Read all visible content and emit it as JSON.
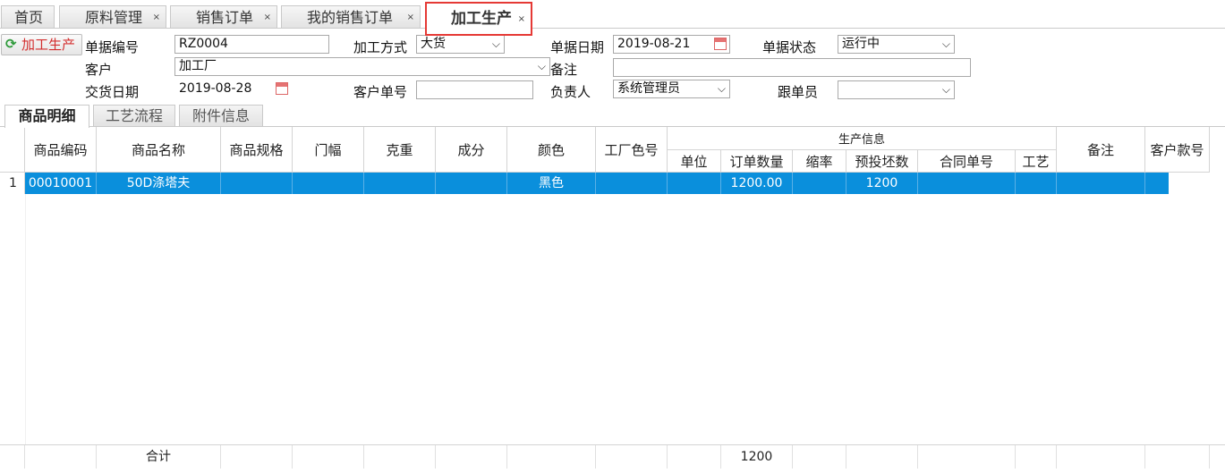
{
  "tabs": [
    {
      "label": "首页",
      "closable": false
    },
    {
      "label": "原料管理",
      "closable": true
    },
    {
      "label": "销售订单",
      "closable": true
    },
    {
      "label": "我的销售订单",
      "closable": true
    },
    {
      "label": "加工生产",
      "closable": true,
      "active": true
    }
  ],
  "close_glyph": "×",
  "action_button": {
    "label": "加工生产",
    "icon": "refresh-icon"
  },
  "form": {
    "doc_no_label": "单据编号",
    "doc_no": "RZ0004",
    "process_method_label": "加工方式",
    "process_method": "大货",
    "doc_date_label": "单据日期",
    "doc_date": "2019-08-21",
    "doc_status_label": "单据状态",
    "doc_status": "运行中",
    "customer_label": "客户",
    "customer": "加工厂",
    "remark_label": "备注",
    "remark": "",
    "delivery_date_label": "交货日期",
    "delivery_date": "2019-08-28",
    "customer_order_label": "客户单号",
    "customer_order": "",
    "owner_label": "负责人",
    "owner": "系统管理员",
    "follower_label": "跟单员",
    "follower": ""
  },
  "subtabs": [
    {
      "label": "商品明细",
      "active": true
    },
    {
      "label": "工艺流程",
      "active": false
    },
    {
      "label": "附件信息",
      "active": false
    }
  ],
  "grid": {
    "headers": {
      "code": "商品编码",
      "name": "商品名称",
      "spec": "商品规格",
      "width": "门幅",
      "weight": "克重",
      "composition": "成分",
      "color": "颜色",
      "factory_color": "工厂色号",
      "production_group": "生产信息",
      "unit": "单位",
      "order_qty": "订单数量",
      "shrink": "缩率",
      "planned_blank": "预投坯数",
      "contract_no": "合同单号",
      "craft": "工艺",
      "remark": "备注",
      "customer_style": "客户款号"
    },
    "rows": [
      {
        "no": "1",
        "code": "00010001",
        "name": "50D涤塔夫",
        "color": "黑色",
        "order_qty": "1200.00",
        "planned_blank": "1200"
      }
    ],
    "footer": {
      "label": "合计",
      "planned_blank_total": "1200"
    }
  },
  "colors": {
    "active_tab_border": "#e53935",
    "selected_row": "#0a8fdc",
    "action_text": "#d32f2f"
  }
}
